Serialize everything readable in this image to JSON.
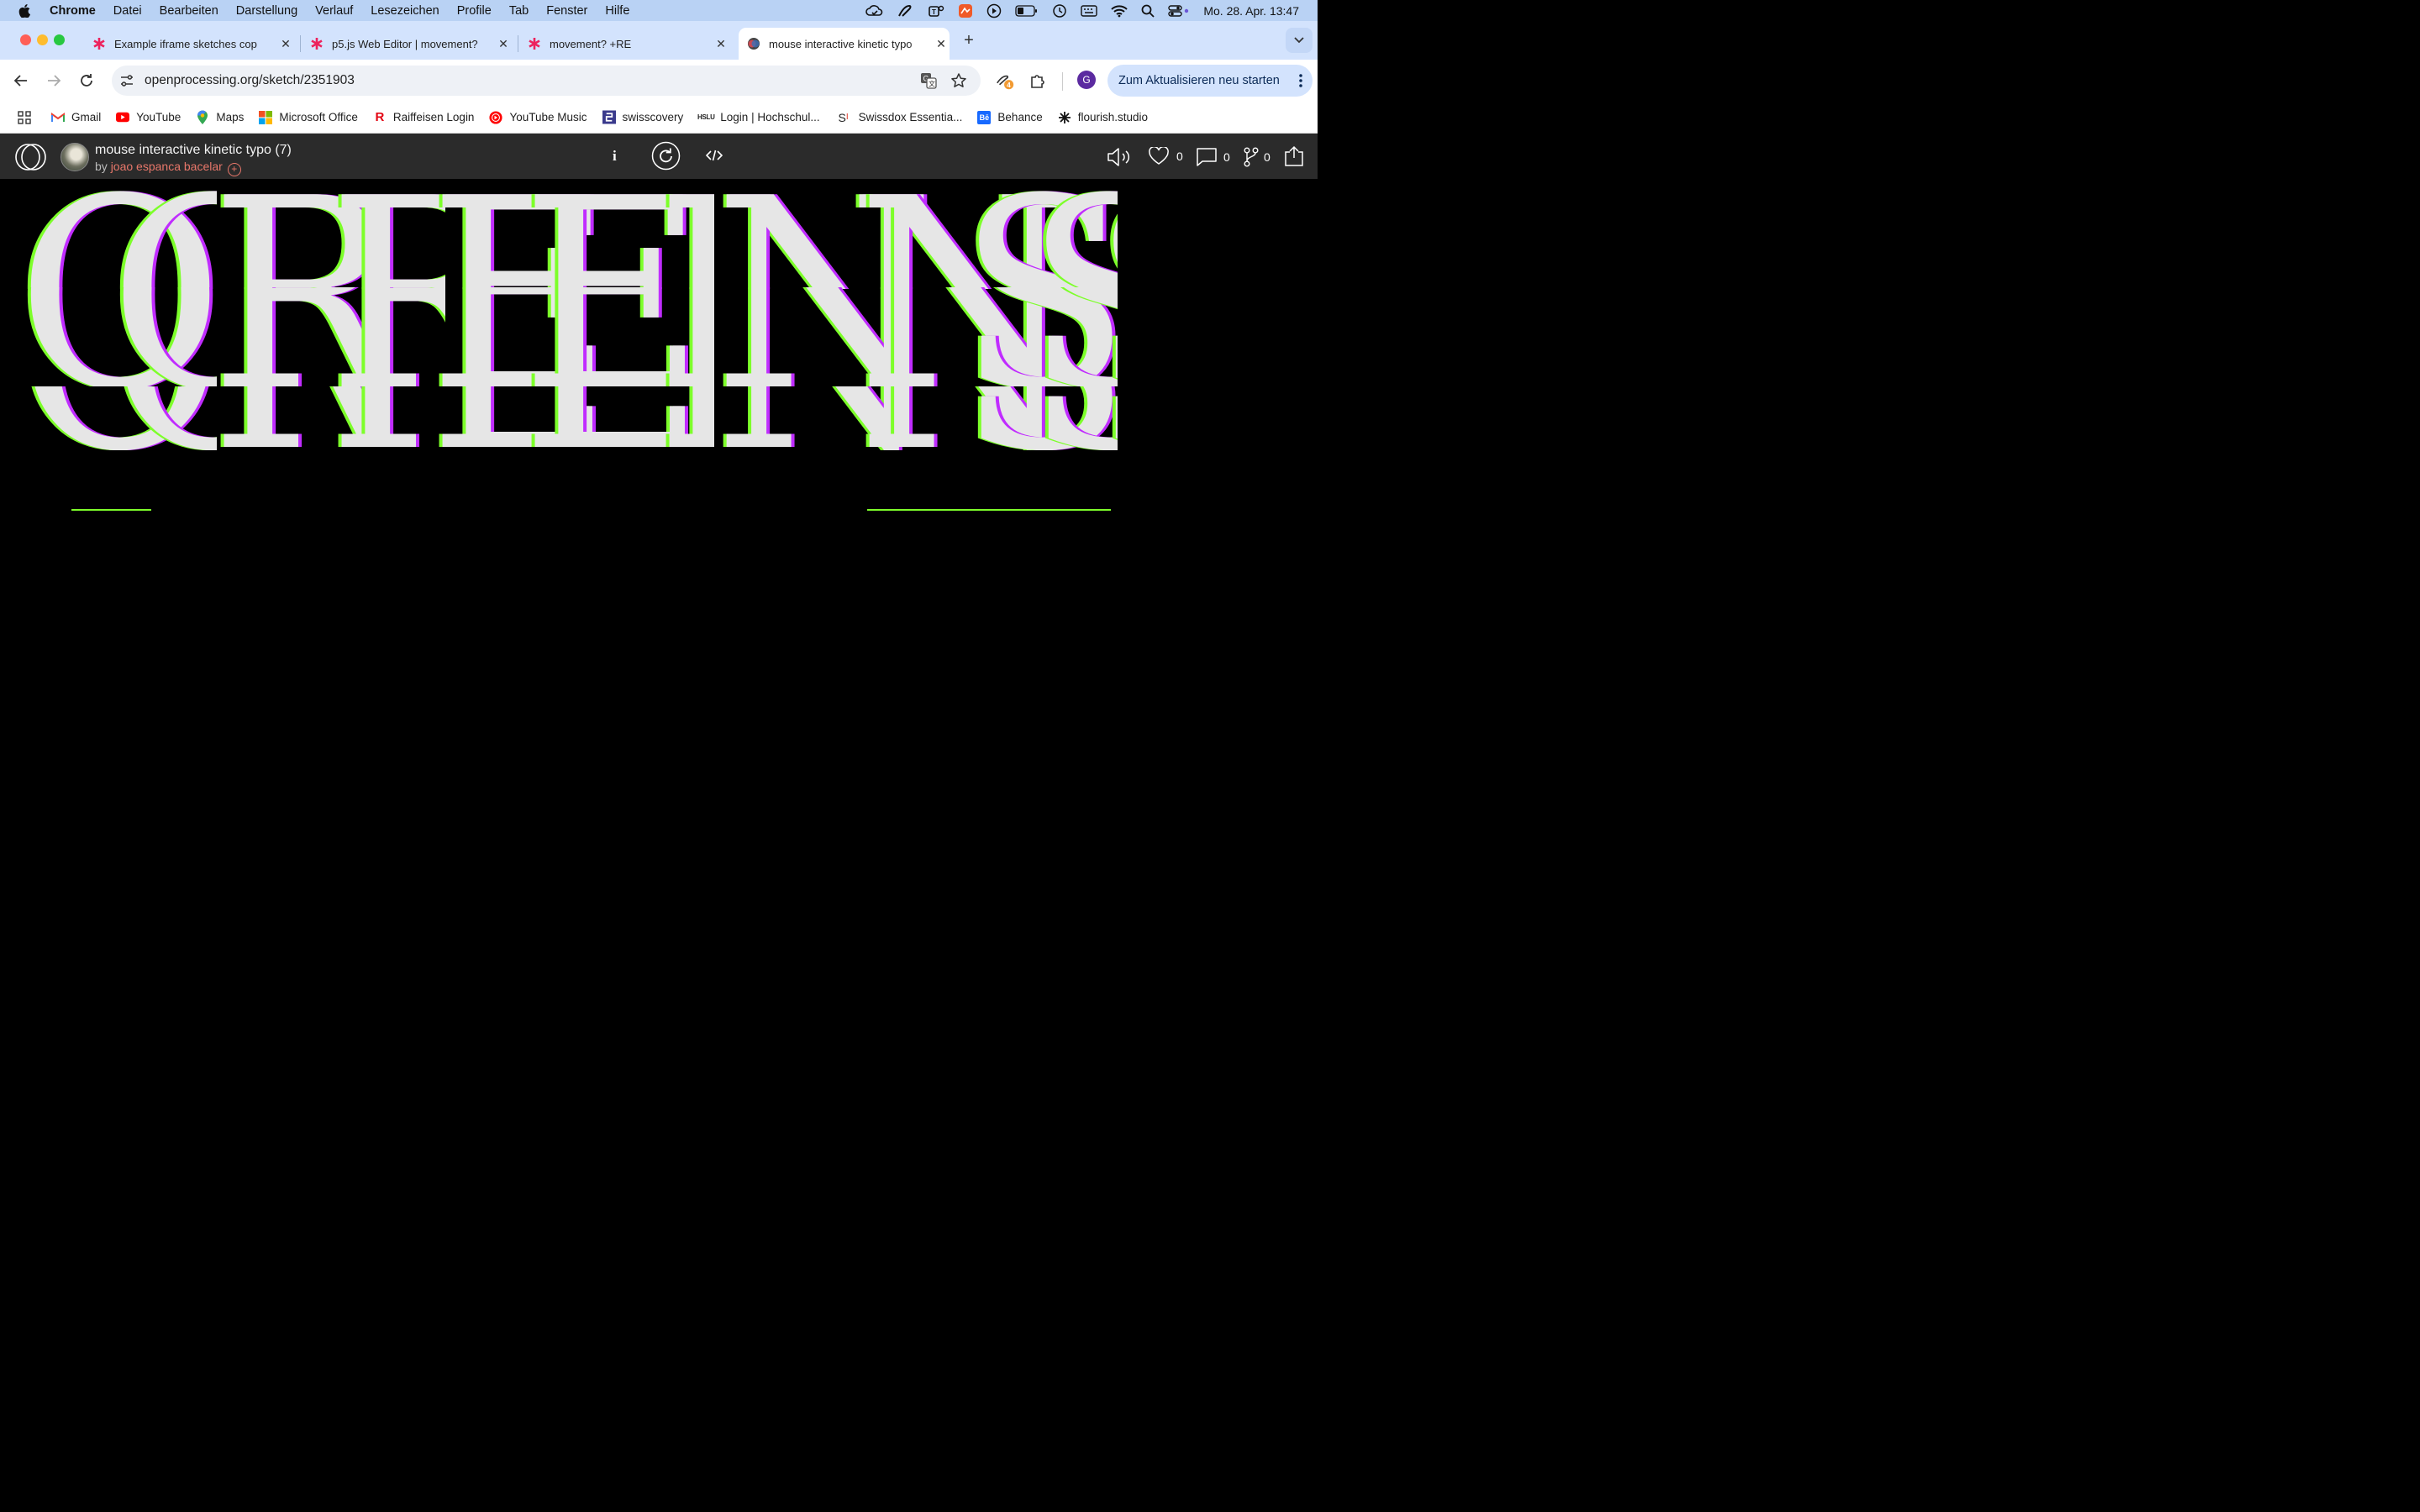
{
  "menubar": {
    "app": "Chrome",
    "items": [
      "Datei",
      "Bearbeiten",
      "Darstellung",
      "Verlauf",
      "Lesezeichen",
      "Profile",
      "Tab",
      "Fenster",
      "Hilfe"
    ],
    "datetime": "Mo. 28. Apr.  13:47"
  },
  "tabs": [
    {
      "title": "Example iframe sketches cop",
      "favicon": "asterisk-icon"
    },
    {
      "title": "p5.js Web Editor | movement?",
      "favicon": "asterisk-icon"
    },
    {
      "title": "movement? +RE",
      "favicon": "asterisk-icon"
    },
    {
      "title": "mouse interactive kinetic typo",
      "favicon": "openprocessing-icon",
      "active": true
    }
  ],
  "toolbar": {
    "url_host": "openprocessing.org",
    "url_path": "/sketch/2351903",
    "update_label": "Zum Aktualisieren neu starten",
    "profile_letter": "G",
    "extension_badge": "4"
  },
  "bookmarks": [
    {
      "label": "Gmail",
      "icon": "gmail-icon"
    },
    {
      "label": "YouTube",
      "icon": "youtube-icon"
    },
    {
      "label": "Maps",
      "icon": "maps-icon"
    },
    {
      "label": "Microsoft Office",
      "icon": "office-icon"
    },
    {
      "label": "Raiffeisen Login",
      "icon": "raiffeisen-icon"
    },
    {
      "label": "YouTube Music",
      "icon": "youtube-music-icon"
    },
    {
      "label": "swisscovery",
      "icon": "swisscovery-icon"
    },
    {
      "label": "Login | Hochschul...",
      "icon": "hslu-icon"
    },
    {
      "label": "Swissdox Essentia...",
      "icon": "swissdox-icon"
    },
    {
      "label": "Behance",
      "icon": "behance-icon"
    },
    {
      "label": "flourish.studio",
      "icon": "flourish-icon"
    }
  ],
  "sketch": {
    "title": "mouse interactive kinetic typo (7)",
    "by": "by",
    "author": "joao espanca bacelar",
    "likes": "0",
    "comments": "0",
    "forks": "0"
  },
  "canvas": {
    "letters": [
      "O",
      "R",
      "E",
      "N",
      "S"
    ],
    "background": "#000000",
    "fill": "#e6e6e6",
    "accent_green": "#7dff2a",
    "accent_magenta": "#c02cff"
  }
}
